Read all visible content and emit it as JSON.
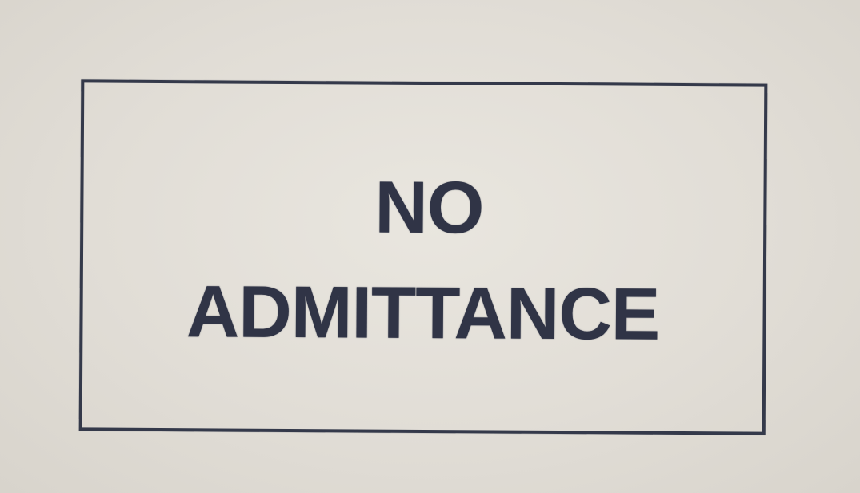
{
  "sign": {
    "line1": "NO",
    "line2": "ADMITTANCE"
  },
  "colors": {
    "paper": "#e2ded7",
    "ink": "#303446",
    "border": "#34394a"
  }
}
